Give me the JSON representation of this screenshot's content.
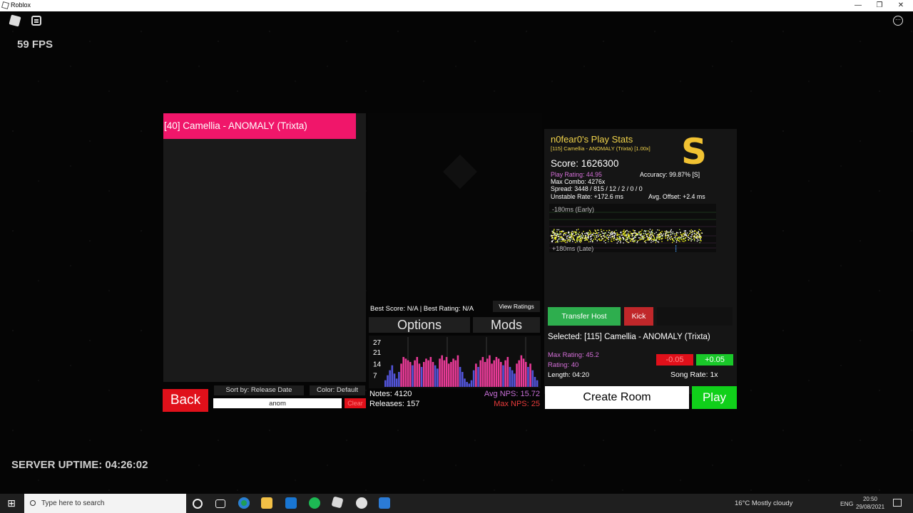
{
  "window": {
    "title": "Roblox"
  },
  "hud": {
    "fps": "59 FPS",
    "server_uptime": "SERVER UPTIME: 04:26:02"
  },
  "song_list": {
    "items": [
      {
        "label": "[40] Camellia - ANOMALY (Trixta)"
      }
    ],
    "back_label": "Back",
    "sort_label": "Sort by: Release Date",
    "color_label": "Color: Default",
    "search_value": "anom",
    "clear_label": "Clear"
  },
  "middle": {
    "best_score": "Best Score: N/A | Best Rating: N/A",
    "view_ratings": "View Ratings",
    "options": "Options",
    "mods": "Mods",
    "notes": "Notes: 4120",
    "releases": "Releases: 157",
    "avg_nps": "Avg NPS: 15.72",
    "max_nps": "Max NPS: 25"
  },
  "play_stats": {
    "title": "n0fear0's Play Stats",
    "song": "[115] Camellia - ANOMALY (Trixta) [1.00x]",
    "grade": "S",
    "score": "Score: 1626300",
    "play_rating": "Play Rating: 44.95",
    "accuracy": "Accuracy: 99.87% [S]",
    "max_combo": "Max Combo: 4276x",
    "spread": "Spread: 3448 / 815 / 12 / 2 / 0 / 0",
    "unstable_rate": "Unstable Rate: +172.6 ms",
    "avg_offset": "Avg. Offset: +2.4 ms",
    "early_label": "-180ms (Early)",
    "late_label": "+180ms (Late)",
    "transfer_host": "Transfer Host",
    "kick": "Kick"
  },
  "selected": {
    "text": "Selected: [115] Camellia - ANOMALY (Trixta)",
    "max_rating": "Max Rating: 45.2",
    "rating": "Rating: 40",
    "length": "Length: 04:20",
    "rate_minus": "-0.05",
    "rate_plus": "+0.05",
    "song_rate": "Song Rate: 1x",
    "create_room": "Create Room",
    "play": "Play"
  },
  "chart_data": {
    "type": "bar",
    "title": "",
    "xlabel": "",
    "ylabel": "",
    "ylim": [
      0,
      30
    ],
    "ytick_labels": [
      "27",
      "21",
      "14",
      "7"
    ],
    "yticks": [
      27,
      21,
      14,
      7
    ],
    "values": [
      4,
      7,
      10,
      13,
      8,
      5,
      9,
      14,
      18,
      17,
      16,
      15,
      13,
      16,
      18,
      14,
      12,
      15,
      17,
      16,
      18,
      15,
      13,
      11,
      17,
      19,
      16,
      18,
      14,
      15,
      17,
      16,
      19,
      12,
      9,
      5,
      3,
      2,
      4,
      10,
      14,
      12,
      16,
      18,
      15,
      17,
      19,
      14,
      16,
      18,
      17,
      15,
      13,
      16,
      18,
      12,
      10,
      8,
      14,
      16,
      19,
      17,
      15,
      12,
      14,
      10,
      6,
      4
    ]
  },
  "taskbar": {
    "search_placeholder": "Type here to search",
    "weather": "16°C  Mostly cloudy",
    "lang": "ENG",
    "time": "20:50",
    "date": "29/08/2021"
  },
  "colors": {
    "song_item": "#f0166a",
    "back": "#e0101a",
    "play": "#10d01a",
    "grade": "#f1c232",
    "transfer": "#2eae4e",
    "kick": "#c0272a",
    "nps_bar_pink": "#ff3fa5",
    "nps_bar_blue": "#5a5cf0"
  }
}
